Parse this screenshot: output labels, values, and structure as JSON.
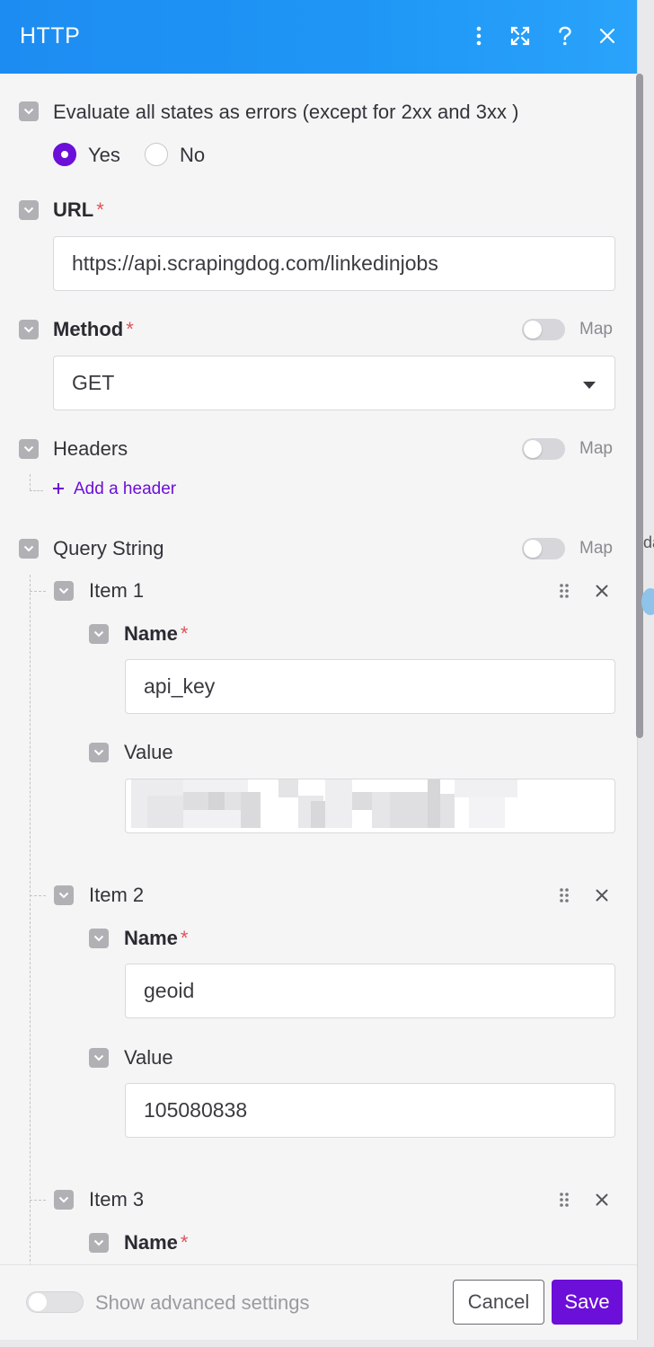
{
  "window": {
    "title": "HTTP"
  },
  "evaluate": {
    "label": "Evaluate all states as errors (except for 2xx and 3xx )",
    "options": [
      "Yes",
      "No"
    ],
    "selected": "Yes"
  },
  "url": {
    "label": "URL",
    "required_mark": "*",
    "value": "https://api.scrapingdog.com/linkedinjobs"
  },
  "method": {
    "label": "Method",
    "required_mark": "*",
    "value": "GET",
    "map_label": "Map"
  },
  "headers": {
    "label": "Headers",
    "map_label": "Map",
    "add_label": "Add a header"
  },
  "query": {
    "label": "Query String",
    "map_label": "Map",
    "items": [
      {
        "title": "Item 1",
        "name_label": "Name",
        "name_value": "api_key",
        "value_label": "Value",
        "value_value": ""
      },
      {
        "title": "Item 2",
        "name_label": "Name",
        "name_value": "geoid",
        "value_label": "Value",
        "value_value": "105080838"
      },
      {
        "title": "Item 3",
        "name_label": "Name"
      }
    ],
    "required_mark": "*"
  },
  "footer": {
    "advanced_label": "Show advanced settings",
    "cancel_label": "Cancel",
    "save_label": "Save"
  },
  "background": {
    "peek_text": "da"
  },
  "colors": {
    "header": "#1f97f6",
    "accent": "#6c0fd8",
    "required": "#e0525a"
  },
  "icons": {
    "more": "more-vertical-icon",
    "expand": "expand-icon",
    "help": "help-icon",
    "close": "close-icon",
    "collapse": "collapse-chevron-icon",
    "drag": "drag-handle-icon",
    "remove": "remove-icon",
    "add": "plus-icon",
    "dropdown": "caret-down-icon"
  }
}
